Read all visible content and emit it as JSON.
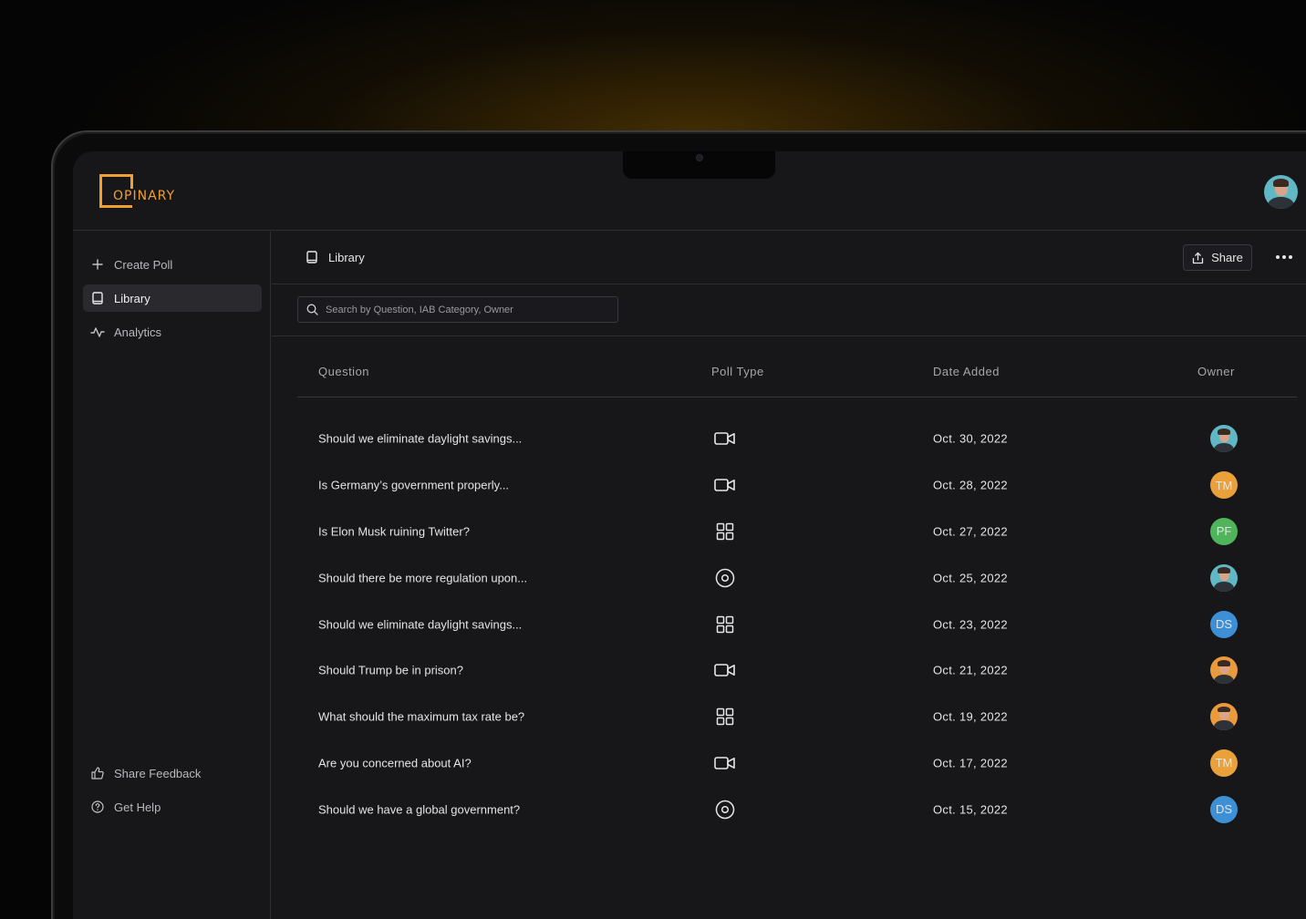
{
  "app": {
    "logo_text": "OPINARY",
    "accent_color": "#f0a030"
  },
  "user": {
    "avatar_icon": "user-photo-avatar"
  },
  "sidebar": {
    "top_items": [
      {
        "label": "Create Poll",
        "icon": "plus-icon"
      },
      {
        "label": "Library",
        "icon": "book-icon",
        "active": true
      },
      {
        "label": "Analytics",
        "icon": "activity-icon"
      }
    ],
    "bottom_items": [
      {
        "label": "Share Feedback",
        "icon": "thumbs-up-icon"
      },
      {
        "label": "Get Help",
        "icon": "help-circle-icon"
      }
    ]
  },
  "header": {
    "breadcrumb": "Library",
    "share_label": "Share",
    "more_icon": "more-horizontal-icon"
  },
  "search": {
    "placeholder": "Search by Question, IAB Category, Owner"
  },
  "table": {
    "columns": [
      "Question",
      "Poll Type",
      "Date Added",
      "Owner"
    ],
    "rows": [
      {
        "question": "Should we eliminate daylight savings...",
        "poll_type": "video",
        "date": "Oct. 30, 2022",
        "owner": {
          "kind": "photo",
          "bg": "#5fb8c4"
        }
      },
      {
        "question": "Is Germany’s government properly...",
        "poll_type": "video",
        "date": "Oct. 28, 2022",
        "owner": {
          "kind": "initials",
          "initials": "TM",
          "bg": "#eaa13a"
        }
      },
      {
        "question": "Is Elon Musk ruining Twitter?",
        "poll_type": "grid",
        "date": "Oct. 27, 2022",
        "owner": {
          "kind": "initials",
          "initials": "PF",
          "bg": "#4fb45a"
        }
      },
      {
        "question": "Should there be more regulation upon...",
        "poll_type": "target",
        "date": "Oct. 25, 2022",
        "owner": {
          "kind": "photo",
          "bg": "#5fb8c4"
        }
      },
      {
        "question": "Should we eliminate daylight savings...",
        "poll_type": "grid",
        "date": "Oct. 23, 2022",
        "owner": {
          "kind": "initials",
          "initials": "DS",
          "bg": "#3d8fd6"
        }
      },
      {
        "question": "Should Trump be in prison?",
        "poll_type": "video",
        "date": "Oct. 21, 2022",
        "owner": {
          "kind": "photo",
          "bg": "#e89a3c"
        }
      },
      {
        "question": "What should the maximum tax rate be?",
        "poll_type": "grid",
        "date": "Oct. 19, 2022",
        "owner": {
          "kind": "photo",
          "bg": "#e89a3c"
        }
      },
      {
        "question": "Are you concerned about AI?",
        "poll_type": "video",
        "date": "Oct. 17, 2022",
        "owner": {
          "kind": "initials",
          "initials": "TM",
          "bg": "#eaa13a"
        }
      },
      {
        "question": "Should we have a global government?",
        "poll_type": "target",
        "date": "Oct. 15, 2022",
        "owner": {
          "kind": "initials",
          "initials": "DS",
          "bg": "#3d8fd6"
        }
      }
    ]
  }
}
